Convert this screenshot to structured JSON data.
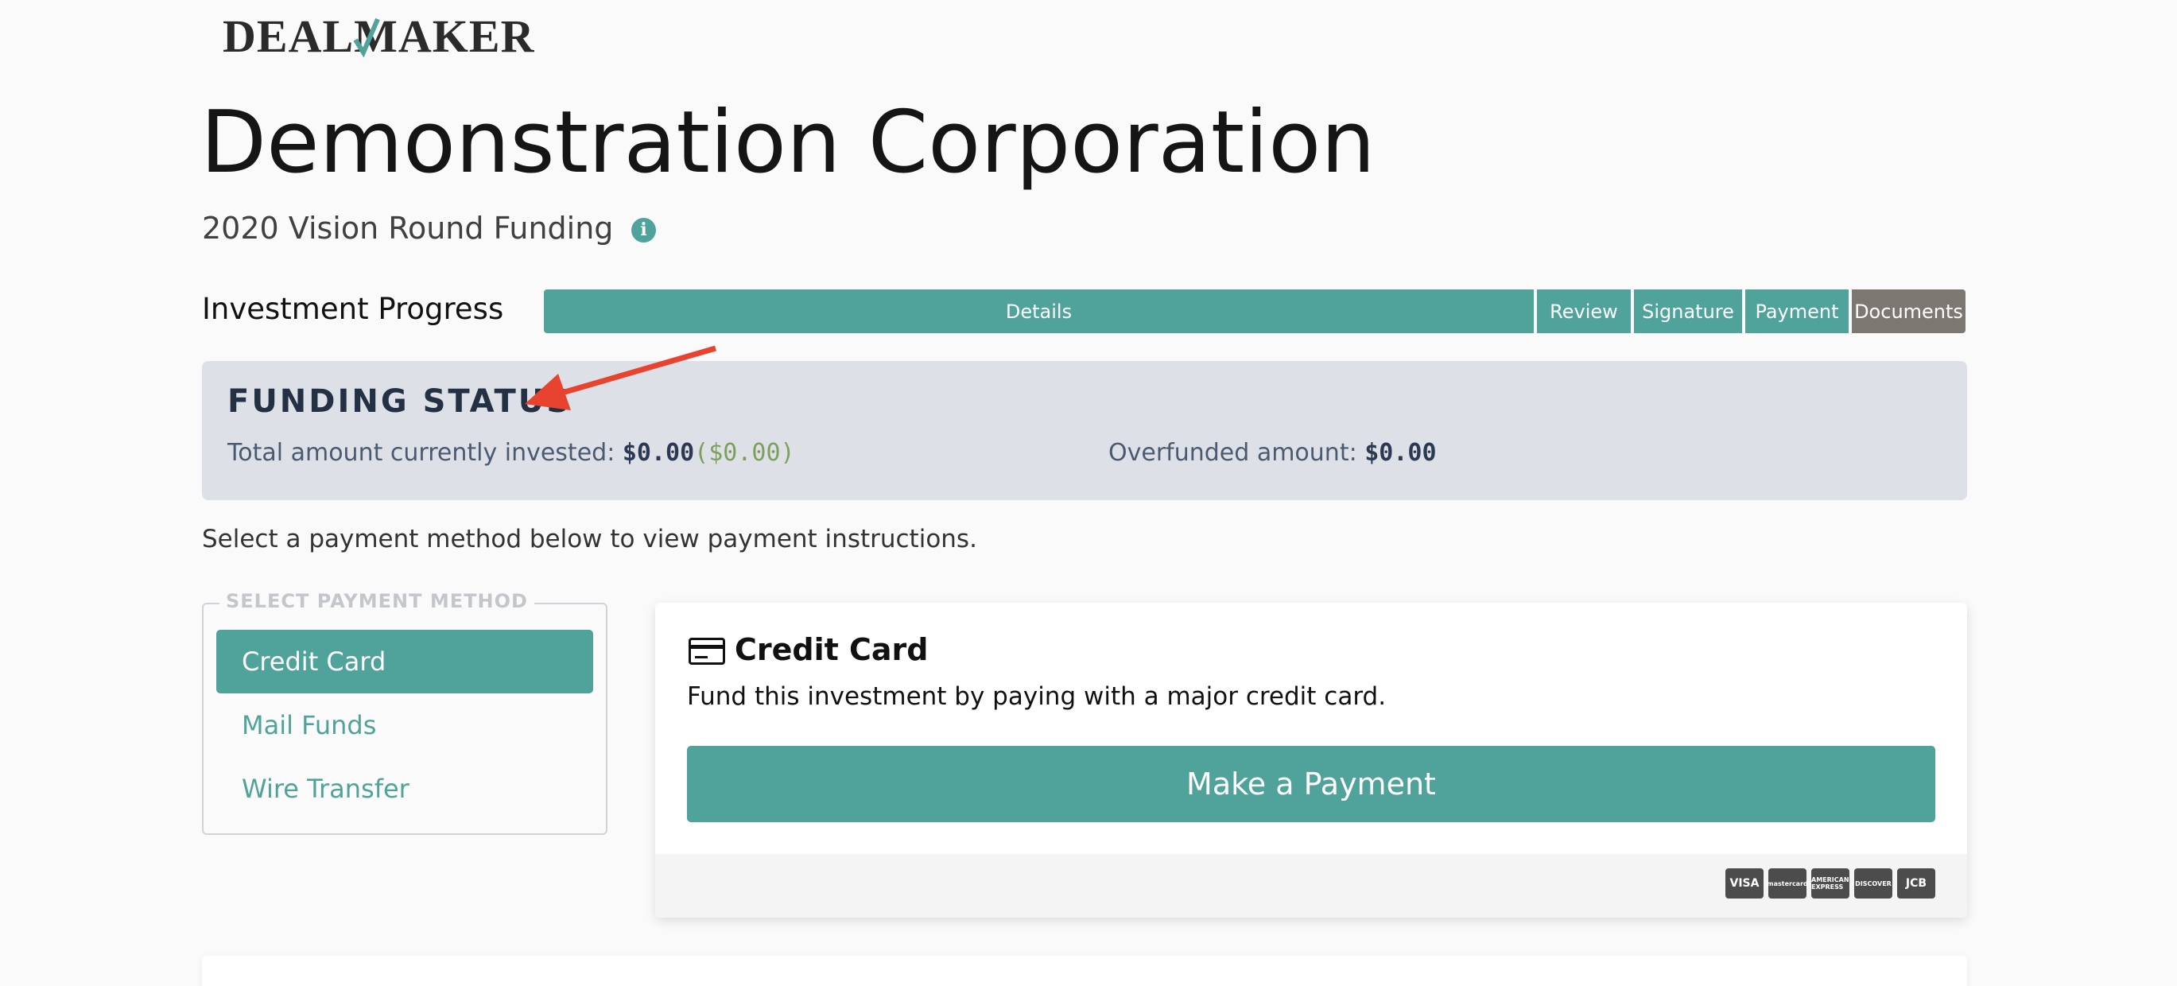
{
  "brand": {
    "logo_text_left": "DEAL",
    "logo_text_m": "M",
    "logo_text_right": "AKER",
    "accent": "#4fa39b"
  },
  "header": {
    "title": "Demonstration Corporation",
    "subtitle": "2020 Vision Round Funding",
    "info_icon": "info-icon"
  },
  "progress": {
    "label": "Investment Progress",
    "steps": [
      {
        "label": "Details"
      },
      {
        "label": "Review"
      },
      {
        "label": "Signature"
      },
      {
        "label": "Payment"
      },
      {
        "label": "Documents"
      }
    ]
  },
  "funding": {
    "title": "FUNDING STATUS",
    "total_label": "Total amount currently invested:",
    "total_value": "$0.00",
    "total_pending": "($0.00)",
    "overfunded_label": "Overfunded amount:",
    "overfunded_value": "$0.00"
  },
  "instructions": "Select a payment method below to view payment instructions.",
  "payment_methods": {
    "legend": "SELECT PAYMENT METHOD",
    "items": [
      {
        "label": "Credit Card",
        "active": true
      },
      {
        "label": "Mail Funds",
        "active": false
      },
      {
        "label": "Wire Transfer",
        "active": false
      }
    ]
  },
  "credit_card": {
    "title": "Credit Card",
    "icon": "credit-card-icon",
    "description": "Fund this investment by paying with a major credit card.",
    "button_label": "Make a Payment",
    "card_logos": [
      "VISA",
      "mastercard",
      "AMERICAN EXPRESS",
      "DISCOVER",
      "JCB"
    ]
  },
  "colors": {
    "teal": "#4fa39b",
    "step_inactive": "#7d7772",
    "funding_bg": "#dde1e7",
    "annotation_arrow": "#e8432f"
  }
}
